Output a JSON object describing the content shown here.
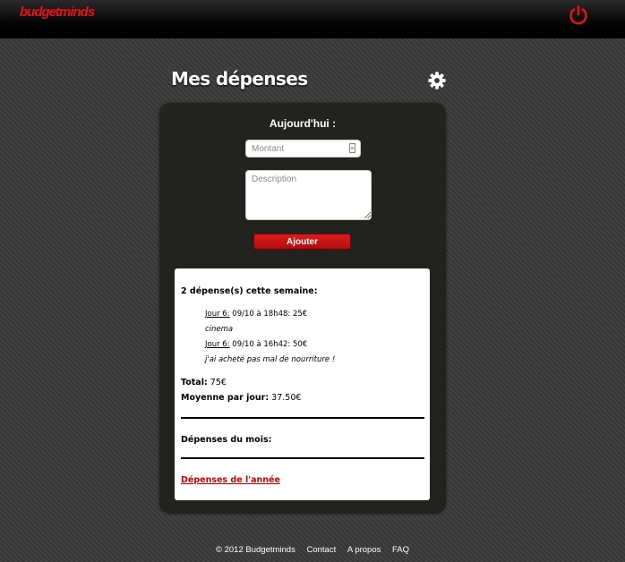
{
  "header": {
    "logo_text": "budgetminds",
    "logout_icon": "power-icon",
    "accent_color": "#e4141b"
  },
  "page": {
    "title": "Mes dépenses",
    "settings_icon": "gear-icon"
  },
  "form": {
    "today_label": "Aujourd'hui :",
    "amount_placeholder": "Montant",
    "amount_value": "",
    "description_placeholder": "Description",
    "description_value": "",
    "add_button": "Ajouter"
  },
  "week": {
    "heading": "2 dépense(s) cette semaine:",
    "expenses": [
      {
        "day": "Jour 6:",
        "detail": " 09/10 à 18h48: 25€",
        "note": "cinema"
      },
      {
        "day": "Jour 6:",
        "detail": " 09/10 à 16h42: 50€",
        "note": "j'ai acheté pas mal de nourriture !"
      }
    ],
    "total_label": "Total:",
    "total_value": " 75€",
    "average_label": "Moyenne par jour:",
    "average_value": " 37.50€"
  },
  "month": {
    "heading": "Dépenses du mois:"
  },
  "year_link": "Dépenses de l'année",
  "footer": {
    "copyright": "© 2012 Budgetminds",
    "links": [
      "Contact",
      "A propos",
      "FAQ"
    ]
  }
}
